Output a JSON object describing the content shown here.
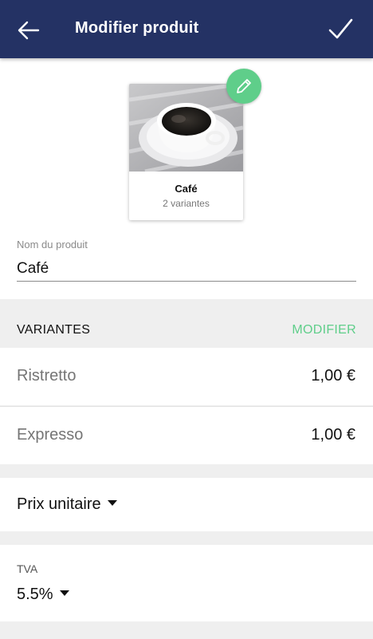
{
  "header": {
    "title": "Modifier produit",
    "back_icon": "arrow-left-icon",
    "confirm_icon": "check-icon",
    "background": "#243264"
  },
  "product": {
    "name": "Café",
    "variants_count": "2 variantes",
    "edit_icon": "pencil-icon"
  },
  "name_field": {
    "label": "Nom du produit",
    "value": "Café"
  },
  "variants": {
    "title": "VARIANTES",
    "action": "MODIFIER",
    "accent": "#5fce8a",
    "items": [
      {
        "name": "Ristretto",
        "price": "1,00 €"
      },
      {
        "name": "Expresso",
        "price": "1,00 €"
      }
    ]
  },
  "pricing": {
    "selected": "Prix unitaire"
  },
  "tva": {
    "label": "TVA",
    "selected": "5.5%"
  }
}
